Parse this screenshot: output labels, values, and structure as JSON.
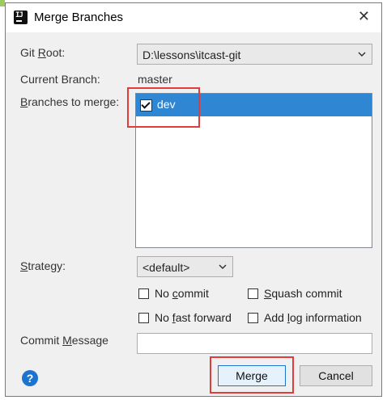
{
  "window": {
    "title": "Merge Branches",
    "close_glyph": "✕",
    "app_icon_glyph": "IJ"
  },
  "form": {
    "git_root_label": "Git Root:",
    "git_root_value": "D:\\lessons\\itcast-git",
    "current_branch_label": "Current Branch:",
    "current_branch_value": "master",
    "branches_label": "Branches to merge:",
    "branches": [
      {
        "name": "dev",
        "checked": true,
        "selected": true
      }
    ],
    "strategy_label": "Strategy:",
    "strategy_value": "<default>",
    "options": [
      {
        "label": "No commit",
        "checked": false
      },
      {
        "label": "Squash commit",
        "checked": false
      },
      {
        "label": "No fast forward",
        "checked": false
      },
      {
        "label": "Add log information",
        "checked": false
      }
    ],
    "commit_message_label": "Commit Message",
    "commit_message_value": ""
  },
  "buttons": {
    "help_glyph": "?",
    "merge": "Merge",
    "cancel": "Cancel"
  },
  "colors": {
    "selection": "#2f86d2",
    "highlight_box": "#e03c3c",
    "help_icon": "#1c74d0"
  }
}
